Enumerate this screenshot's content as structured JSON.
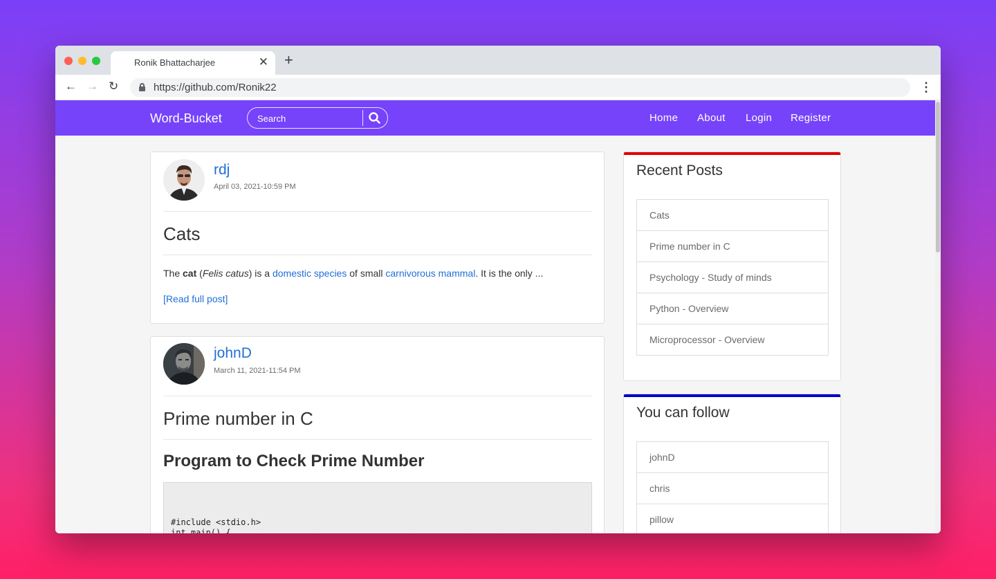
{
  "browser": {
    "tab_title": "Ronik Bhattacharjee",
    "tab_close": "✕",
    "new_tab": "+",
    "url": "https://github.com/Ronik22",
    "back": "←",
    "forward": "→",
    "reload": "↻",
    "menu": "⋮"
  },
  "navbar": {
    "brand": "Word-Bucket",
    "search_placeholder": "Search",
    "links": [
      "Home",
      "About",
      "Login",
      "Register"
    ]
  },
  "posts": [
    {
      "author": "rdj",
      "date": "April 03, 2021-10:59 PM",
      "title": "Cats",
      "excerpt": {
        "t1": "The ",
        "bold": "cat",
        "t2": " (",
        "italic": "Felis catus",
        "t3": ") is a ",
        "link1": "domestic species",
        "t4": " of small ",
        "link2": "carnivorous mammal",
        "t5": ". It is the only ..."
      },
      "read_more": "[Read full post]"
    },
    {
      "author": "johnD",
      "date": "March 11, 2021-11:54 PM",
      "title": "Prime number in C",
      "subheading": "Program to Check Prime Number",
      "code": "#include <stdio.h>\nint main() {"
    }
  ],
  "sidebar": {
    "recent_title": "Recent Posts",
    "recent_accent": "#e00000",
    "recent_posts": [
      "Cats",
      "Prime number in C",
      "Psychology - Study of minds",
      "Python - Overview",
      "Microprocessor - Overview"
    ],
    "follow_title": "You can follow",
    "follow_accent": "#0000cc",
    "follow_users": [
      "johnD",
      "chris",
      "pillow"
    ]
  },
  "colors": {
    "navbar": "#7643fb",
    "link": "#1f6fd6"
  }
}
